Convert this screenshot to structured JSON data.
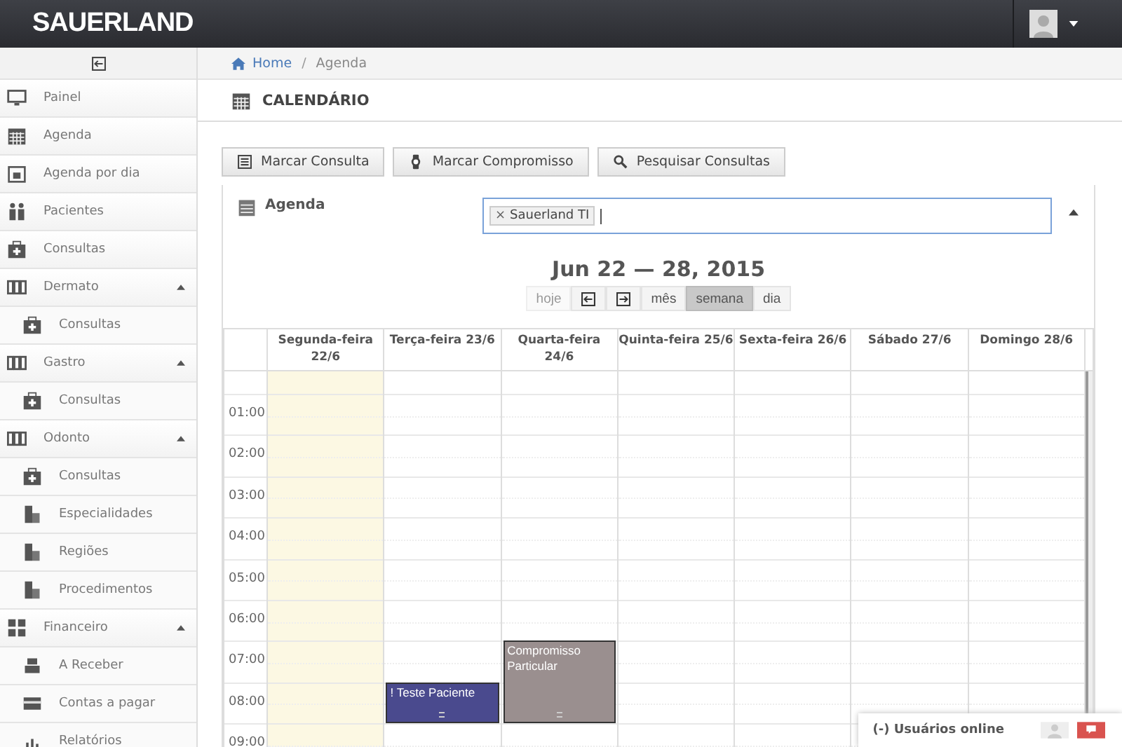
{
  "header": {
    "logo": "SAUERLAND"
  },
  "sidebar": {
    "items": [
      {
        "label": "Painel",
        "kind": "monitor"
      },
      {
        "label": "Agenda",
        "kind": "calendar"
      },
      {
        "label": "Agenda por dia",
        "kind": "day"
      },
      {
        "label": "Pacientes",
        "kind": "people"
      },
      {
        "label": "Consultas",
        "kind": "medkit"
      },
      {
        "label": "Dermato",
        "kind": "columns",
        "expanded": true,
        "children": [
          {
            "label": "Consultas",
            "kind": "medkit"
          }
        ]
      },
      {
        "label": "Gastro",
        "kind": "columns",
        "expanded": true,
        "children": [
          {
            "label": "Consultas",
            "kind": "medkit"
          }
        ]
      },
      {
        "label": "Odonto",
        "kind": "columns",
        "expanded": true,
        "children": [
          {
            "label": "Consultas",
            "kind": "medkit"
          },
          {
            "label": "Especialidades",
            "kind": "building"
          },
          {
            "label": "Regiões",
            "kind": "building"
          },
          {
            "label": "Procedimentos",
            "kind": "building"
          }
        ]
      },
      {
        "label": "Financeiro",
        "kind": "dashboard",
        "expanded": true,
        "children": [
          {
            "label": "A Receber",
            "kind": "register"
          },
          {
            "label": "Contas a pagar",
            "kind": "card"
          },
          {
            "label": "Relatórios",
            "kind": "chart"
          }
        ]
      }
    ]
  },
  "breadcrumb": {
    "separator": "/",
    "items": [
      {
        "label": "Home",
        "kind": "link"
      },
      {
        "label": "Agenda",
        "kind": "current"
      }
    ]
  },
  "page_title": "CALENDÁRIO",
  "actions": [
    {
      "label": "Marcar Consulta",
      "kind": "form"
    },
    {
      "label": "Marcar Compromisso",
      "kind": "watch"
    },
    {
      "label": "Pesquisar Consultas",
      "kind": "search"
    }
  ],
  "agenda_panel": {
    "title": "Agenda",
    "tags": [
      {
        "label": "Sauerland TI",
        "remove": "×"
      }
    ]
  },
  "calendar": {
    "title": "Jun 22 — 28, 2015",
    "nav": [
      {
        "label": "hoje",
        "kind": "text",
        "selected": false,
        "disabled": true
      },
      {
        "kind": "prev",
        "selected": false,
        "disabled": false
      },
      {
        "kind": "next",
        "selected": false,
        "disabled": false
      },
      {
        "label": "mês",
        "kind": "text",
        "selected": false,
        "disabled": false
      },
      {
        "label": "semana",
        "kind": "text",
        "selected": true,
        "disabled": false
      },
      {
        "label": "dia",
        "kind": "text",
        "selected": false,
        "disabled": false
      }
    ],
    "days": [
      {
        "label": "Segunda-feira 22/6",
        "today": true
      },
      {
        "label": "Terça-feira 23/6",
        "today": false,
        "events_by_start": {
          "08:00": {
            "title": "! Teste Paciente",
            "color": "#4a4a8e",
            "kind": "one-hour"
          }
        }
      },
      {
        "label": "Quarta-feira 24/6",
        "today": false,
        "events_by_start": {
          "07:00": {
            "title": "Compromisso Particular",
            "color": "#9a8f8f",
            "kind": "two-hour"
          }
        }
      },
      {
        "label": "Quinta-feira 25/6",
        "today": false
      },
      {
        "label": "Sexta-feira 26/6",
        "today": false
      },
      {
        "label": "Sábado 27/6",
        "today": false
      },
      {
        "label": "Domingo 28/6",
        "today": false
      }
    ],
    "hours": [
      {
        "label": "01:00"
      },
      {
        "label": "02:00"
      },
      {
        "label": "03:00"
      },
      {
        "label": "04:00"
      },
      {
        "label": "05:00"
      },
      {
        "label": "06:00"
      },
      {
        "label": "07:00"
      },
      {
        "label": "08:00"
      },
      {
        "label": "09:00"
      }
    ]
  },
  "online_widget": {
    "label": "(-) Usuários online"
  }
}
